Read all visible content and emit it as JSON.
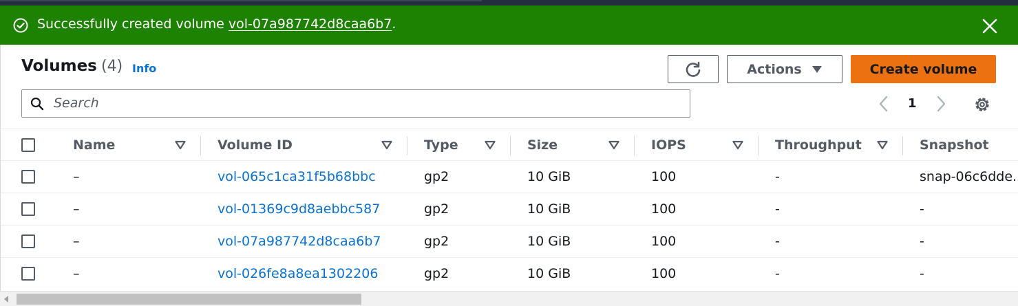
{
  "banner": {
    "message_prefix": "Successfully created volume ",
    "volume_link": "vol-07a987742d8caa6b7",
    "message_suffix": ".",
    "status_color": "#1d8102"
  },
  "header": {
    "title": "Volumes",
    "count": "(4)",
    "info_link": "Info"
  },
  "toolbar": {
    "refresh_icon": "refresh-icon",
    "actions_label": "Actions",
    "create_label": "Create volume",
    "create_color": "#ec7211"
  },
  "search": {
    "placeholder": "Search",
    "value": ""
  },
  "pagination": {
    "current_page": "1"
  },
  "table": {
    "columns": [
      "Name",
      "Volume ID",
      "Type",
      "Size",
      "IOPS",
      "Throughput",
      "Snapshot"
    ],
    "rows": [
      {
        "name": "–",
        "volume_id": "vol-065c1ca31f5b68bbc",
        "type": "gp2",
        "size": "10 GiB",
        "iops": "100",
        "throughput": "-",
        "snapshot": "snap-06c6dde."
      },
      {
        "name": "–",
        "volume_id": "vol-01369c9d8aebbc587",
        "type": "gp2",
        "size": "10 GiB",
        "iops": "100",
        "throughput": "-",
        "snapshot": "-"
      },
      {
        "name": "–",
        "volume_id": "vol-07a987742d8caa6b7",
        "type": "gp2",
        "size": "10 GiB",
        "iops": "100",
        "throughput": "-",
        "snapshot": "-"
      },
      {
        "name": "–",
        "volume_id": "vol-026fe8a8ea1302206",
        "type": "gp2",
        "size": "10 GiB",
        "iops": "100",
        "throughput": "-",
        "snapshot": "-"
      }
    ]
  },
  "colors": {
    "link": "#0972d3",
    "text": "#16191f",
    "muted": "#545b64"
  }
}
